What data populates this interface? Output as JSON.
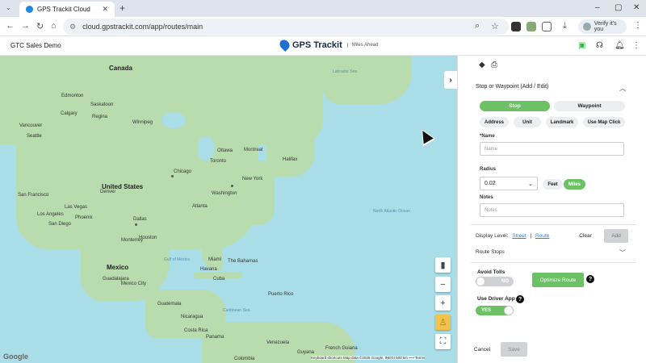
{
  "browser": {
    "tab_title": "GPS Trackit Cloud",
    "new_tab": "+",
    "url": "cloud.gpstrackit.com/app/routes/main",
    "verify_label": "Verify it's you"
  },
  "app": {
    "company": "GTC Sales Demo",
    "brand": "GPS Trackit",
    "tagline": "Miles Ahead"
  },
  "map": {
    "labels": {
      "canada": "Canada",
      "united_states": "United States",
      "mexico": "Mexico",
      "north_atlantic": "North Atlantic Ocean",
      "labrador_sea": "Labrador Sea",
      "gulf_mexico": "Gulf of Mexico",
      "caribbean": "Caribbean Sea",
      "edmonton": "Edmonton",
      "calgary": "Calgary",
      "vancouver": "Vancouver",
      "seattle": "Seattle",
      "winnipeg": "Winnipeg",
      "regina": "Regina",
      "saskatoon": "Saskatoon",
      "ottawa": "Ottawa",
      "montreal": "Montreal",
      "toronto": "Toronto",
      "chicago": "Chicago",
      "new_york": "New York",
      "washington": "Washington",
      "san_francisco": "San Francisco",
      "las_vegas": "Las Vegas",
      "los_angeles": "Los Angeles",
      "san_diego": "San Diego",
      "phoenix": "Phoenix",
      "dallas": "Dallas",
      "houston": "Houston",
      "miami": "Miami",
      "atlanta": "Atlanta",
      "denver": "Denver",
      "monterrey": "Monterrey",
      "guadalajara": "Guadalajara",
      "mexico_city": "Mexico City",
      "cuba": "Cuba",
      "havana": "Havana",
      "puerto_rico": "Puerto Rico",
      "guatemala": "Guatemala",
      "nicaragua": "Nicaragua",
      "costa_rica": "Costa Rica",
      "panama": "Panama",
      "venezuela": "Venezuela",
      "colombia": "Colombia",
      "french_guiana": "French Guiana",
      "halifax": "Halifax",
      "bahamas": "The Bahamas",
      "guyana": "Guyana"
    },
    "google": "Google",
    "attribution": "Keyboard shortcuts   Map data ©2025 Google, INEGI   500 km ⎯⎯⎯   Terms"
  },
  "panel": {
    "section_title": "Stop or Waypoint (Add / Edit)",
    "seg_stop": "Stop",
    "seg_waypoint": "Waypoint",
    "chips": [
      "Address",
      "Unit",
      "Landmark",
      "Use Map Click"
    ],
    "name_label": "*Name",
    "name_placeholder": "Name",
    "radius_label": "Radius",
    "radius_value": "0.02",
    "unit_feet": "Feet",
    "unit_miles": "Miles",
    "notes_label": "Notes",
    "notes_placeholder": "Notes",
    "display_level_label": "Display Level:",
    "display_street": "Street",
    "display_sep": "|",
    "display_route": "Route",
    "clear_label": "Clear",
    "add_label": "Add",
    "route_stops_label": "Route Stops",
    "avoid_tolls_label": "Avoid Tolls",
    "avoid_tolls_value": "NO",
    "optimize_label": "Optimize Route",
    "driver_app_label": "Use Driver App",
    "driver_app_value": "YES",
    "cancel_label": "Cancel",
    "save_label": "Save"
  },
  "colors": {
    "accent_green": "#6cc166",
    "map_water": "#a9dde8",
    "map_land": "#b8dcae",
    "link_blue": "#1e88e5"
  }
}
